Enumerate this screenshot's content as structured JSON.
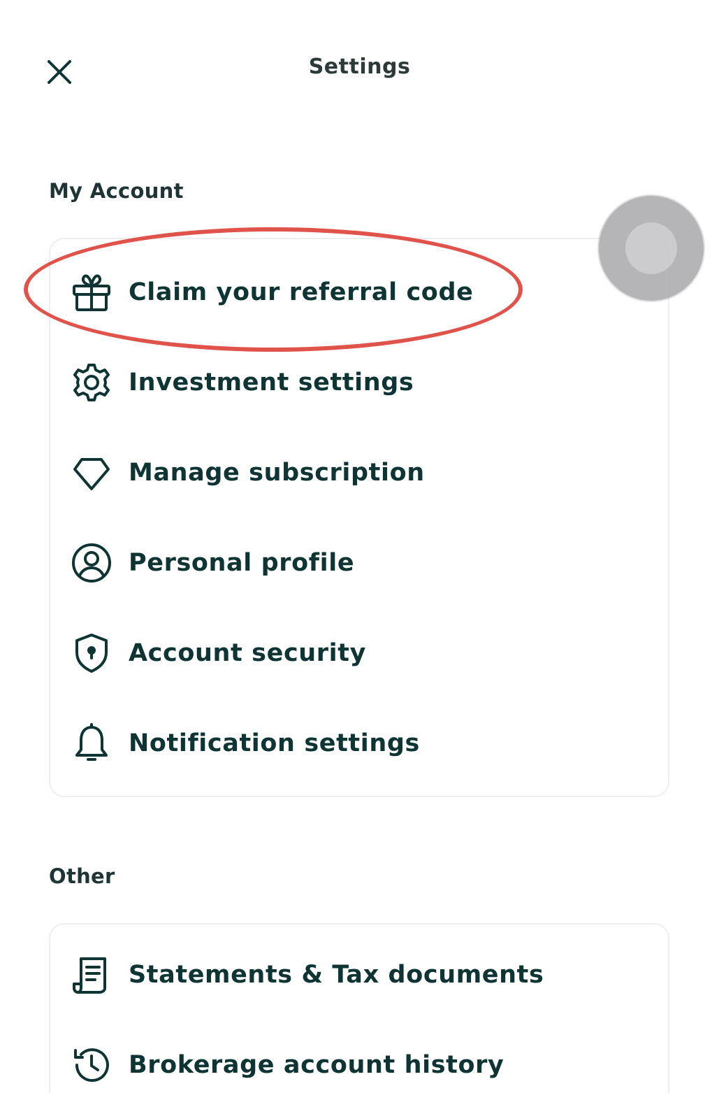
{
  "header": {
    "title": "Settings"
  },
  "sections": {
    "my_account": {
      "title": "My Account",
      "items": [
        {
          "label": "Claim your referral code",
          "icon": "gift-icon"
        },
        {
          "label": "Investment settings",
          "icon": "gear-icon"
        },
        {
          "label": "Manage subscription",
          "icon": "diamond-icon"
        },
        {
          "label": "Personal profile",
          "icon": "user-circle-icon"
        },
        {
          "label": "Account security",
          "icon": "shield-lock-icon"
        },
        {
          "label": "Notification settings",
          "icon": "bell-icon"
        }
      ]
    },
    "other": {
      "title": "Other",
      "items": [
        {
          "label": "Statements & Tax documents",
          "icon": "document-icon"
        },
        {
          "label": "Brokerage account history",
          "icon": "history-icon"
        }
      ]
    }
  },
  "colors": {
    "accent": "#0f3434",
    "highlight": "#e0534a",
    "card_border": "#eeeef0"
  }
}
